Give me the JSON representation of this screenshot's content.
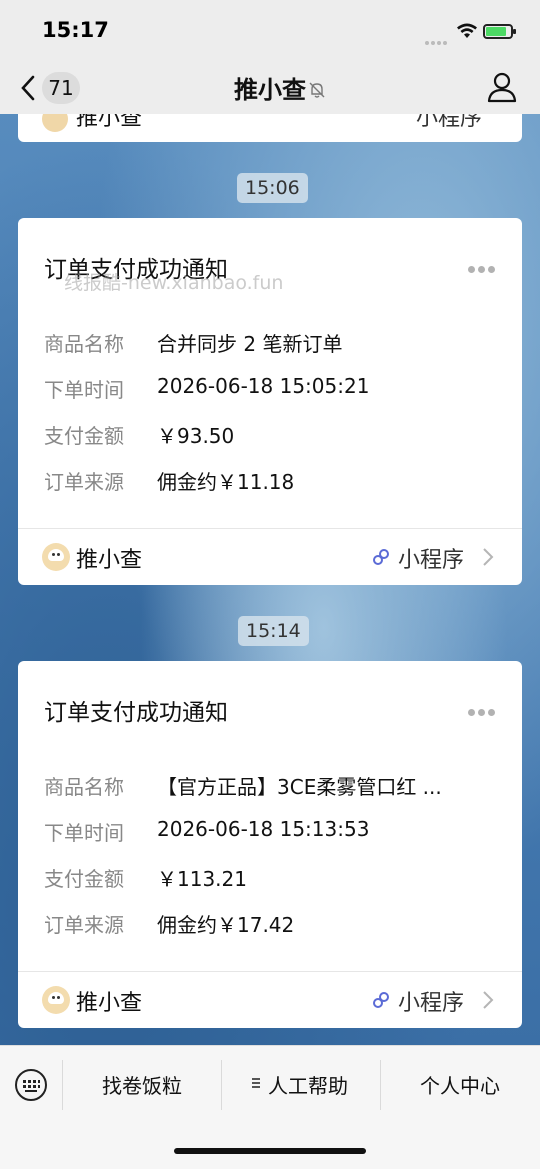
{
  "status_bar": {
    "time": "15:17"
  },
  "nav": {
    "back_count": "71",
    "title": "推小查"
  },
  "top_card_partial": {
    "name": "推小查",
    "link": "小程序"
  },
  "messages": [
    {
      "timestamp": "15:06",
      "title": "订单支付成功通知",
      "watermark": "线报酷-new.xianbao.fun",
      "rows": [
        {
          "label": "商品名称",
          "value": "合并同步 2 笔新订单"
        },
        {
          "label": "下单时间",
          "value": "2026-06-18 15:05:21"
        },
        {
          "label": "支付金额",
          "value": "￥93.50"
        },
        {
          "label": "订单来源",
          "value": "佣金约￥11.18"
        }
      ],
      "footer": {
        "name": "推小查",
        "link": "小程序"
      }
    },
    {
      "timestamp": "15:14",
      "title": "订单支付成功通知",
      "rows": [
        {
          "label": "商品名称",
          "value": "【官方正品】3CE柔雾管口红 ..."
        },
        {
          "label": "下单时间",
          "value": "2026-06-18 15:13:53"
        },
        {
          "label": "支付金额",
          "value": "￥113.21"
        },
        {
          "label": "订单来源",
          "value": "佣金约￥17.42"
        }
      ],
      "footer": {
        "name": "推小查",
        "link": "小程序"
      }
    }
  ],
  "bottom_menu": {
    "items": [
      "找卷饭粒",
      "人工帮助",
      "个人中心"
    ]
  },
  "colors": {
    "background_blue": "#4a7fb5",
    "card": "#ffffff",
    "bar": "#ededed"
  }
}
